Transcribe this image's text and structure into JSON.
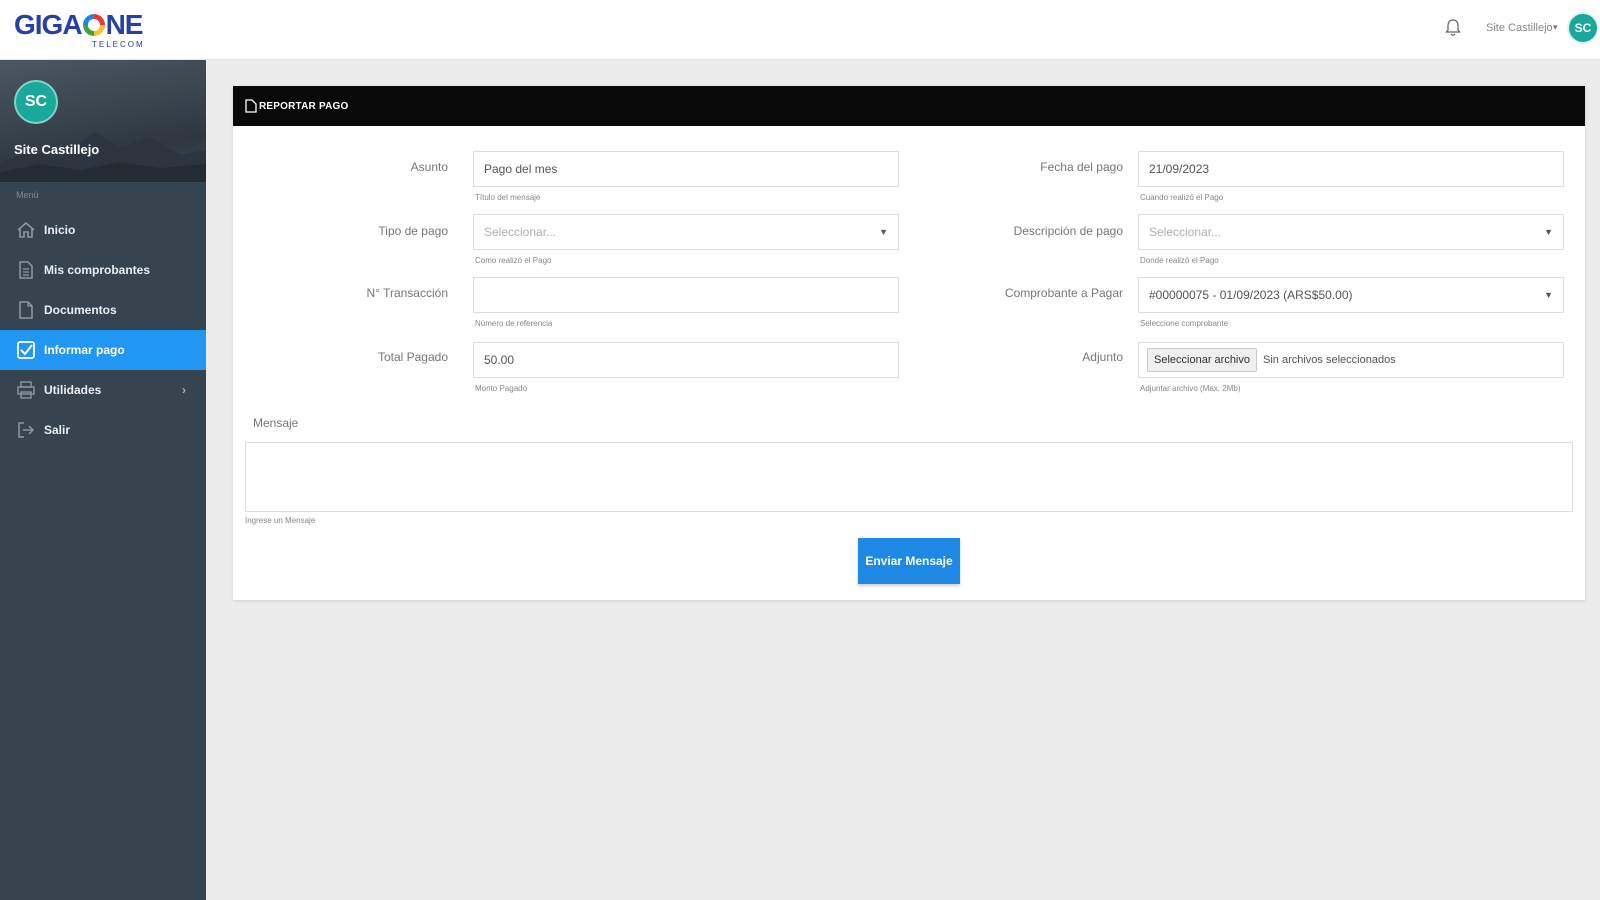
{
  "header": {
    "logo_main": "GIGA",
    "logo_main_end": "NE",
    "logo_sub": "TELECOM",
    "user_name": "Site Castillejo",
    "user_initials": "SC"
  },
  "sidebar": {
    "profile_initials": "SC",
    "profile_name": "Site Castillejo",
    "menu_label": "Menú",
    "items": [
      {
        "label": "Inicio",
        "icon": "home-icon"
      },
      {
        "label": "Mis comprobantes",
        "icon": "file-icon"
      },
      {
        "label": "Documentos",
        "icon": "document-icon"
      },
      {
        "label": "Informar pago",
        "icon": "checkbox-icon",
        "active": true
      },
      {
        "label": "Utilidades",
        "icon": "printer-icon",
        "has_children": true
      },
      {
        "label": "Salir",
        "icon": "logout-icon"
      }
    ]
  },
  "card": {
    "title": "REPORTAR PAGO"
  },
  "form": {
    "asunto": {
      "label": "Asunto",
      "value": "Pago del mes",
      "help": "Título del mensaje"
    },
    "tipo_pago": {
      "label": "Tipo de pago",
      "value": "Seleccionar...",
      "help": "Como realizó el Pago"
    },
    "transaccion": {
      "label": "N° Transacción",
      "value": "",
      "help": "Número de referencia"
    },
    "total": {
      "label": "Total Pagado",
      "value": "50.00",
      "help": "Monto Pagado"
    },
    "fecha": {
      "label": "Fecha del pago",
      "value": "21/09/2023",
      "help": "Cuando realizó el Pago"
    },
    "descripcion": {
      "label": "Descripción de pago",
      "value": "Seleccionar...",
      "help": "Donde realizó el Pago"
    },
    "comprobante": {
      "label": "Comprobante a Pagar",
      "value": "#00000075 - 01/09/2023 (ARS$50.00)",
      "help": "Seleccione comprobante"
    },
    "adjunto": {
      "label": "Adjunto",
      "button": "Seleccionar archivo",
      "status": "Sin archivos seleccionados",
      "help": "Adjuntar archivo (Max. 2Mb)"
    },
    "mensaje": {
      "label": "Mensaje",
      "value": "",
      "help": "Ingrese un Mensaje"
    },
    "submit_label": "Enviar Mensaje"
  }
}
